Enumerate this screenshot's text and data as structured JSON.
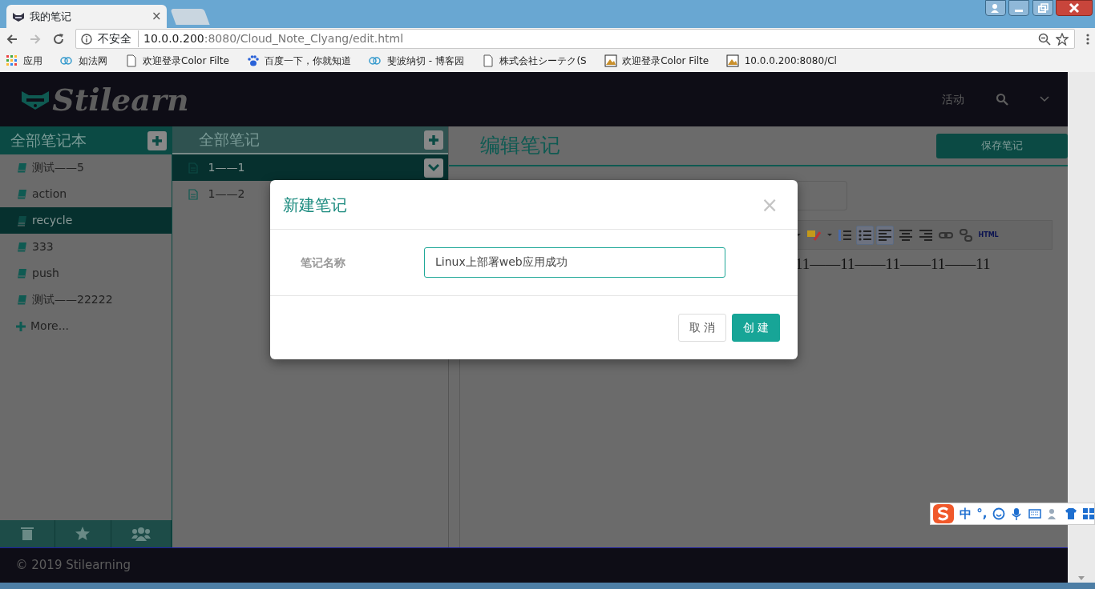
{
  "browser": {
    "tab_title": "我的笔记",
    "tab_close": "×",
    "security": "不安全",
    "host": "10.0.0.200",
    "path": ":8080/Cloud_Note_Clyang/edit.html",
    "bookmarks": [
      {
        "kind": "apps",
        "label": "应用"
      },
      {
        "kind": "site",
        "label": "如法网"
      },
      {
        "kind": "page",
        "label": "欢迎登录Color Filte"
      },
      {
        "kind": "paw",
        "label": "百度一下，你就知道"
      },
      {
        "kind": "site",
        "label": "斐波纳切 - 博客园"
      },
      {
        "kind": "page",
        "label": "株式会社シーテク(S"
      },
      {
        "kind": "image",
        "label": "欢迎登录Color Filte"
      },
      {
        "kind": "image",
        "label": "10.0.0.200:8080/Cl"
      }
    ]
  },
  "header": {
    "logo": "Stilearn",
    "nav": "活动"
  },
  "notebooks": {
    "title": "全部笔记本",
    "items": [
      {
        "label": "测试——5",
        "selected": false
      },
      {
        "label": "action",
        "selected": false
      },
      {
        "label": "recycle",
        "selected": true
      },
      {
        "label": "333",
        "selected": false
      },
      {
        "label": "push",
        "selected": false
      },
      {
        "label": "测试——22222",
        "selected": false
      }
    ],
    "more": "More..."
  },
  "notes": {
    "title": "全部笔记",
    "items": [
      {
        "label": "1——1",
        "selected": true
      },
      {
        "label": "1——2",
        "selected": false
      }
    ]
  },
  "editor": {
    "title": "编辑笔记",
    "save_button": "保存笔记",
    "toolbar": [
      {
        "kind": "caret",
        "selected": false
      },
      {
        "kind": "highlight",
        "selected": false
      },
      {
        "kind": "caret",
        "selected": false
      },
      {
        "kind": "ordered-list",
        "selected": false
      },
      {
        "kind": "bullet-list",
        "selected": true
      },
      {
        "kind": "align-left",
        "selected": true
      },
      {
        "kind": "align-center",
        "selected": false
      },
      {
        "kind": "align-right",
        "selected": false
      },
      {
        "kind": "link",
        "selected": false
      },
      {
        "kind": "unlink",
        "selected": false
      },
      {
        "kind": "html",
        "selected": false,
        "label": "HTML"
      }
    ],
    "content": "11——11——11——11——11"
  },
  "modal": {
    "title": "新建笔记",
    "close": "×",
    "field_label": "笔记名称",
    "field_value": "Linux上部署web应用成功",
    "buttons": [
      {
        "label": "取 消",
        "kind": "default"
      },
      {
        "label": "创 建",
        "kind": "primary"
      }
    ]
  },
  "footer": "© 2019 Stilearning",
  "ime": {
    "mode": "中",
    "punct": "°,"
  }
}
